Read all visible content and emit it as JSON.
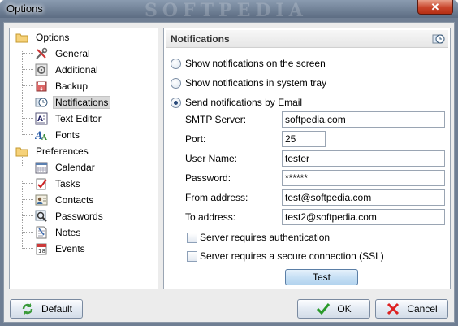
{
  "window": {
    "title": "Options",
    "watermark": "SOFTPEDIA",
    "close_label": "✕"
  },
  "tree": {
    "items": [
      {
        "label": "Options",
        "icon": "folder-icon",
        "level": 0
      },
      {
        "label": "General",
        "icon": "tools-icon",
        "level": 1
      },
      {
        "label": "Additional",
        "icon": "gear-icon",
        "level": 1
      },
      {
        "label": "Backup",
        "icon": "backup-icon",
        "level": 1
      },
      {
        "label": "Notifications",
        "icon": "notification-clock-icon",
        "level": 1,
        "selected": true
      },
      {
        "label": "Text Editor",
        "icon": "text-editor-icon",
        "level": 1
      },
      {
        "label": "Fonts",
        "icon": "fonts-icon",
        "level": 1
      },
      {
        "label": "Preferences",
        "icon": "folder-icon",
        "level": 0
      },
      {
        "label": "Calendar",
        "icon": "calendar-icon",
        "level": 1
      },
      {
        "label": "Tasks",
        "icon": "tasks-icon",
        "level": 1
      },
      {
        "label": "Contacts",
        "icon": "contacts-icon",
        "level": 1
      },
      {
        "label": "Passwords",
        "icon": "passwords-icon",
        "level": 1
      },
      {
        "label": "Notes",
        "icon": "notes-icon",
        "level": 1
      },
      {
        "label": "Events",
        "icon": "events-icon",
        "level": 1
      }
    ]
  },
  "panel": {
    "title": "Notifications",
    "radios": [
      {
        "label": "Show notifications on the screen",
        "checked": false
      },
      {
        "label": "Show notifications in system tray",
        "checked": false
      },
      {
        "label": "Send notifications by Email",
        "checked": true
      }
    ],
    "fields": {
      "smtp": {
        "label": "SMTP Server:",
        "value": "softpedia.com"
      },
      "port": {
        "label": "Port:",
        "value": "25"
      },
      "user": {
        "label": "User Name:",
        "value": "tester"
      },
      "password": {
        "label": "Password:",
        "value": "******"
      },
      "from": {
        "label": "From address:",
        "value": "test@softpedia.com"
      },
      "to": {
        "label": "To address:",
        "value": "test2@softpedia.com"
      }
    },
    "checks": {
      "auth": {
        "label": "Server requires authentication",
        "checked": false
      },
      "ssl": {
        "label": "Server requires a secure connection (SSL)",
        "checked": false
      }
    },
    "test_label": "Test"
  },
  "buttons": {
    "default_label": "Default",
    "ok_label": "OK",
    "cancel_label": "Cancel"
  },
  "colors": {
    "title_bar": "#6f7e93",
    "close": "#c8442a",
    "client_bg": "#ececec",
    "selection": "#d9d9d9"
  }
}
